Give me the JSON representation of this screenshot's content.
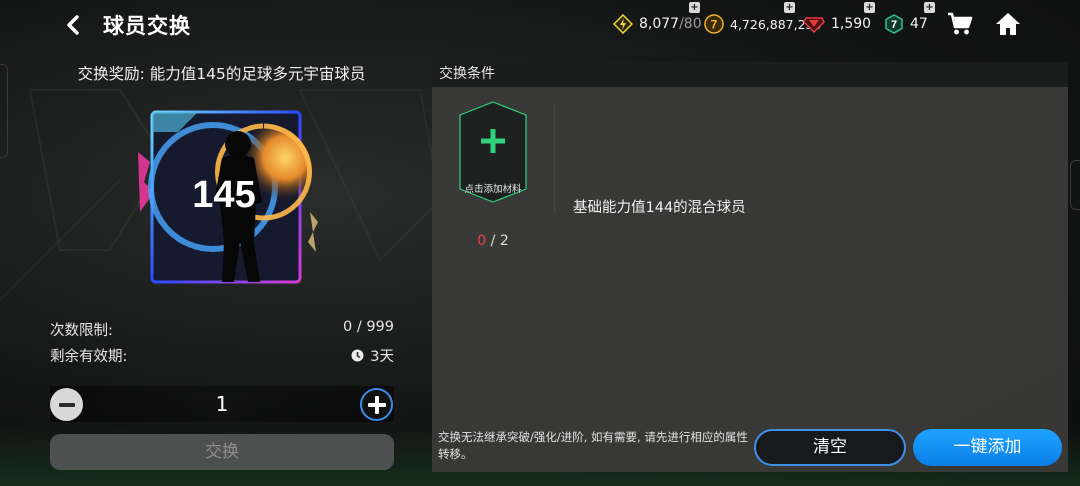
{
  "header": {
    "title": "球员交换",
    "currencies": [
      {
        "name": "energy",
        "value": "8,077",
        "max": "/80",
        "color": "#f3d23a"
      },
      {
        "name": "coins",
        "value": "4,726,887,250",
        "color": "#f0b429"
      },
      {
        "name": "gems",
        "value": "1,590",
        "color": "#e33b3b"
      },
      {
        "name": "tokens",
        "value": "47",
        "color": "#2fbf8f"
      }
    ],
    "icons": {
      "back": "chevron-left-icon",
      "cart": "cart-icon",
      "home": "home-icon"
    }
  },
  "reward": {
    "title": "交换奖励: 能力值145的足球多元宇宙球员",
    "card_rating": "145"
  },
  "limits": {
    "count_label": "次数限制:",
    "count_value": "0 / 999",
    "expiry_label": "剩余有效期:",
    "expiry_value": "3天"
  },
  "stepper": {
    "quantity": "1"
  },
  "buttons": {
    "exchange": "交换",
    "clear": "清空",
    "auto_add": "一键添加"
  },
  "conditions": {
    "header": "交换条件",
    "slot_text": "点击添加材料",
    "progress_current": "0",
    "progress_total": "2",
    "requirement": "基础能力值144的混合球员",
    "note": "交换无法继承突破/强化/进阶, 如有需要, 请先进行相应的属性转移。"
  },
  "colors": {
    "accent_blue": "#1fa3ff",
    "slot_green": "#2fd17a",
    "progress_red": "#e24444"
  }
}
